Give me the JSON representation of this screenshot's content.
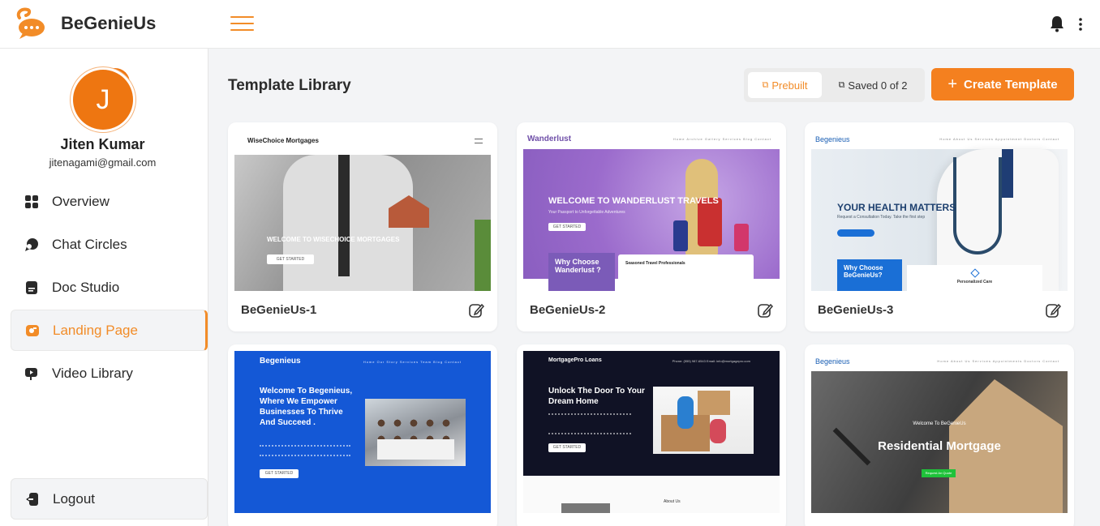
{
  "brand": {
    "name": "BeGenieUs",
    "accent": "#f28c28"
  },
  "header": {
    "menu_icon": "hamburger-icon",
    "notifications_icon": "bell-icon",
    "more_icon": "kebab-icon"
  },
  "user": {
    "initial": "J",
    "name": "Jiten Kumar",
    "email": "jitenagami@gmail.com"
  },
  "sidebar": {
    "items": [
      {
        "label": "Overview",
        "icon": "grid-icon",
        "active": false
      },
      {
        "label": "Chat Circles",
        "icon": "chat-circles-icon",
        "active": false
      },
      {
        "label": "Doc Studio",
        "icon": "doc-icon",
        "active": false
      },
      {
        "label": "Landing Page",
        "icon": "landing-page-icon",
        "active": true
      },
      {
        "label": "Video Library",
        "icon": "video-icon",
        "active": false
      }
    ],
    "logout": "Logout"
  },
  "main": {
    "title": "Template Library",
    "toggle": {
      "prebuilt": "Prebuilt",
      "saved": "Saved 0 of 2"
    },
    "create_button": "Create Template"
  },
  "templates": [
    {
      "name": "BeGenieUs-1",
      "logo": "WiseChoice Mortgages",
      "hero": "WELCOME TO WISECHOICE MORTGAGES",
      "cta": "GET STARTED"
    },
    {
      "name": "BeGenieUs-2",
      "logo": "Wanderlust",
      "links": "Home  Archive  Gallery  Services  Blog  Contact",
      "hero": "WELCOME TO WANDERLUST TRAVELS",
      "sub": "Your Passport to Unforgettable Adventures",
      "cta": "GET STARTED",
      "box_title": "Why Choose Wanderlust ?",
      "feature": "Seasoned Travel Professionals"
    },
    {
      "name": "BeGenieUs-3",
      "logo": "Begenieus",
      "links": "Home  About Us  Services  Appointment  Doctors  Contact",
      "hero": "YOUR HEALTH MATTERS",
      "sub": "Request a Consultation Today. Take the first step",
      "box_title": "Why Choose BeGenieUs?",
      "feature": "Personalized Care"
    },
    {
      "logo": "Begenieus",
      "links": "Home  Our Story  Services  Team  Blog  Contact",
      "hero": "Welcome To Begenieus, Where We Empower Businesses To Thrive And Succeed .",
      "cta": "GET STARTED"
    },
    {
      "logo": "MortgagePro Loans",
      "links": "Phone: (555) 987-6543    Email: info@mortgagepro.com",
      "hero": "Unlock The Door To Your Dream Home",
      "cta": "GET STARTED",
      "footer": "About Us"
    },
    {
      "logo": "Begenieus",
      "links": "Home  About Us  Services  Appointments  Doctors  Contact",
      "small": "Welcome To BeGenieUs",
      "hero": "Residential   Mortgage",
      "cta": "Request An Quote"
    }
  ]
}
